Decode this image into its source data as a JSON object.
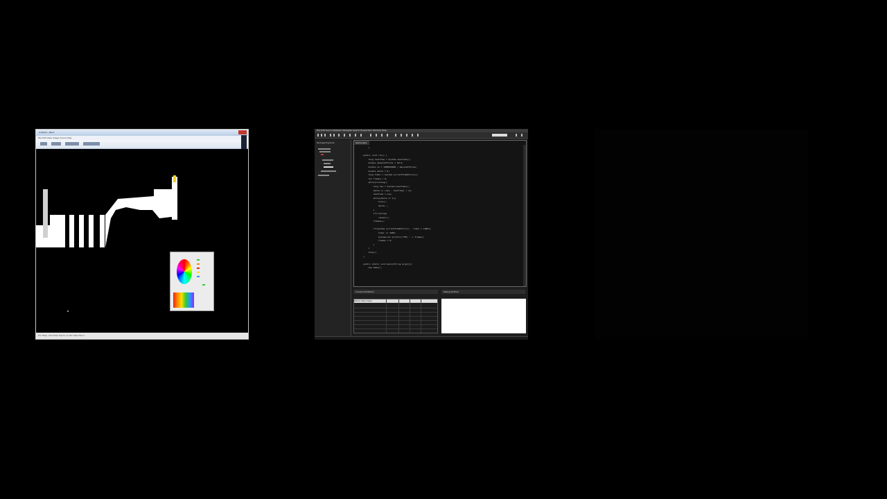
{
  "paint": {
    "title": "Untitled - Paint",
    "menu": "File  Edit  View  Image  Colors  Help",
    "status": "For Help, click Help Topics on the Help Menu."
  },
  "ide": {
    "menu": "File  Edit  Source  Refactor  Navigate  Search  Project  Run  Window  Help",
    "project_header": "Package Explorer",
    "editor_tab": "Game.java",
    "code_lines": [
      "        }",
      "",
      "    public void run() {",
      "        long lastTime = System.nanoTime();",
      "        double amountOfTicks = 60.0;",
      "        double ns = 1000000000 / amountOfTicks;",
      "        double delta = 0;",
      "        long timer = System.currentTimeMillis();",
      "        int frames = 0;",
      "        while(running){",
      "            long now = System.nanoTime();",
      "            delta += (now - lastTime) / ns;",
      "            lastTime = now;",
      "            while(delta >= 1){",
      "                tick();",
      "                delta--;",
      "            }",
      "            if(running)",
      "                render();",
      "            frames++;",
      "",
      "            if(System.currentTimeMillis() - timer > 1000){",
      "                timer += 1000;",
      "                System.out.println(\"FPS: \" + frames);",
      "                frames = 0;",
      "            }",
      "        }",
      "        stop();",
      "    }",
      "",
      "    public static void main(String args[]){",
      "        new Game();"
    ],
    "console_tabs": "Console  Problems",
    "right_tabs": "Debug  Outline",
    "table_header": "Name    Value   Type"
  },
  "colors": {
    "background": "#000000",
    "ide_bg": "#1e1e1e",
    "paint_titlebar": "#b9cde6"
  }
}
